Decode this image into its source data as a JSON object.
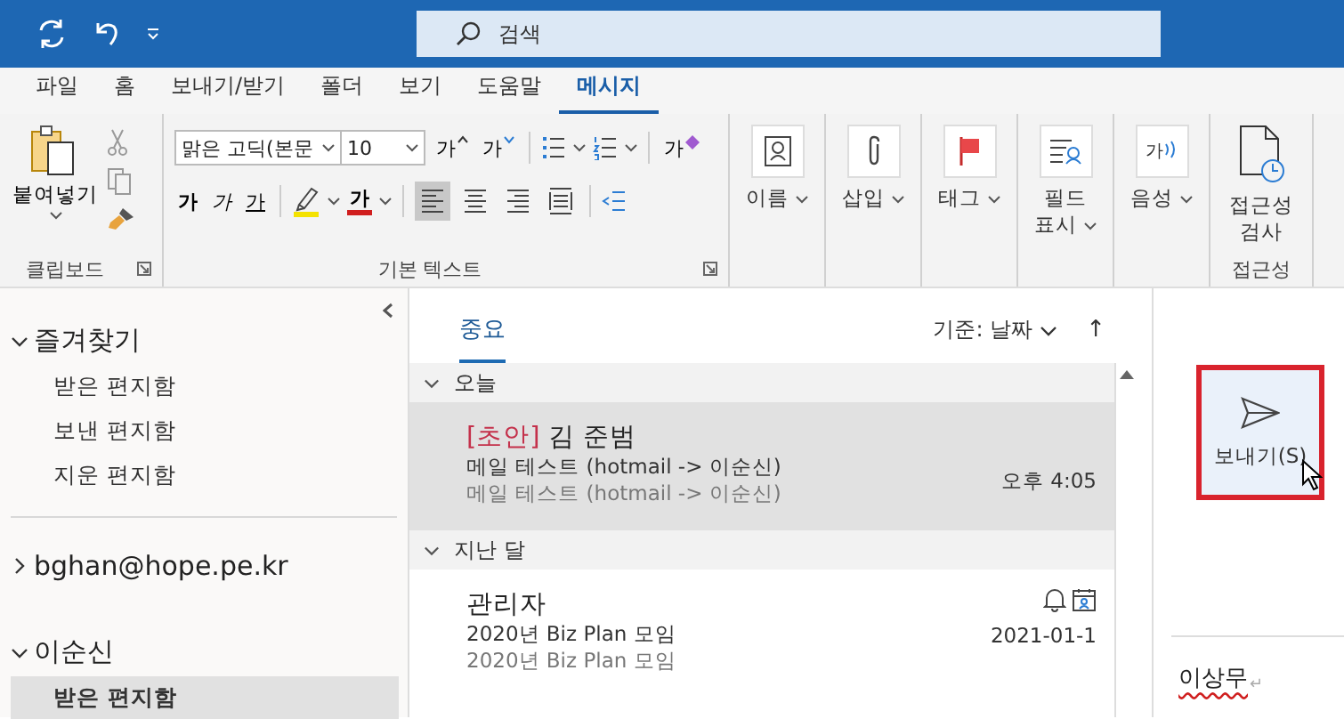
{
  "title_bar": {
    "search_placeholder": "검색"
  },
  "menu_tabs": [
    {
      "label": "파일",
      "selected": false
    },
    {
      "label": "홈",
      "selected": false
    },
    {
      "label": "보내기/받기",
      "selected": false
    },
    {
      "label": "폴더",
      "selected": false
    },
    {
      "label": "보기",
      "selected": false
    },
    {
      "label": "도움말",
      "selected": false
    },
    {
      "label": "메시지",
      "selected": true
    }
  ],
  "ribbon": {
    "clipboard": {
      "paste_label": "붙여넣기",
      "group_label": "클립보드"
    },
    "basic_text": {
      "font": "맑은 고딕(본문",
      "size": "10",
      "grow": "가",
      "shrink": "가",
      "bold": "가",
      "italic": "가",
      "underline": "가",
      "font_color": "가",
      "clear_format": "가",
      "group_label": "기본 텍스트",
      "align": [
        {
          "kind": "left",
          "selected": true
        },
        {
          "kind": "center",
          "selected": false
        },
        {
          "kind": "right",
          "selected": false
        },
        {
          "kind": "justify",
          "selected": false
        }
      ]
    },
    "large_buttons": [
      {
        "kind": "names",
        "label": "이름",
        "caret": true
      },
      {
        "kind": "attach",
        "label": "삽입",
        "caret": true
      },
      {
        "kind": "flag",
        "label": "태그",
        "caret": true
      },
      {
        "kind": "fields",
        "label": "필드 표시",
        "caret": true
      },
      {
        "kind": "voice",
        "label": "음성",
        "icon_text": "가",
        "caret": true
      },
      {
        "kind": "accessibility",
        "label": "접근성 검사",
        "caret": false,
        "group_label": "접근성"
      }
    ]
  },
  "nav": {
    "sections": [
      {
        "label": "즐겨찾기",
        "expanded": true,
        "items": [
          {
            "label": "받은 편지함",
            "selected": false
          },
          {
            "label": "보낸 편지함",
            "selected": false
          },
          {
            "label": "지운 편지함",
            "selected": false
          }
        ]
      },
      {
        "label": "bghan@hope.pe.kr",
        "expanded": false
      },
      {
        "label": "이순신",
        "expanded": true,
        "items": [
          {
            "label": "받은 편지함",
            "selected": true
          }
        ]
      }
    ]
  },
  "message_list": {
    "tabs": [
      {
        "label": "중요",
        "selected": true
      }
    ],
    "sort": "기준: 날짜",
    "sort_direction": "↑",
    "groups": [
      {
        "label": "오늘",
        "expanded": true,
        "messages": [
          {
            "tag": "[초안]",
            "sender": "김 준범",
            "subject": "메일 테스트 (hotmail -> 이순신)",
            "preview": "메일 테스트 (hotmail -> 이순신)",
            "time": "오후 4:05",
            "selected": true,
            "reminder": false
          }
        ]
      },
      {
        "label": "지난 달",
        "expanded": true,
        "messages": [
          {
            "sender": "관리자",
            "subject": "2020년 Biz Plan 모임",
            "preview": "2020년 Biz Plan 모임",
            "time": "2021-01-1",
            "selected": false,
            "reminder": true
          }
        ]
      }
    ]
  },
  "compose": {
    "send_label": "보내기(S)",
    "highlighted": true,
    "body": "이상무",
    "paragraph_mark": "↵",
    "misspelled": true
  }
}
